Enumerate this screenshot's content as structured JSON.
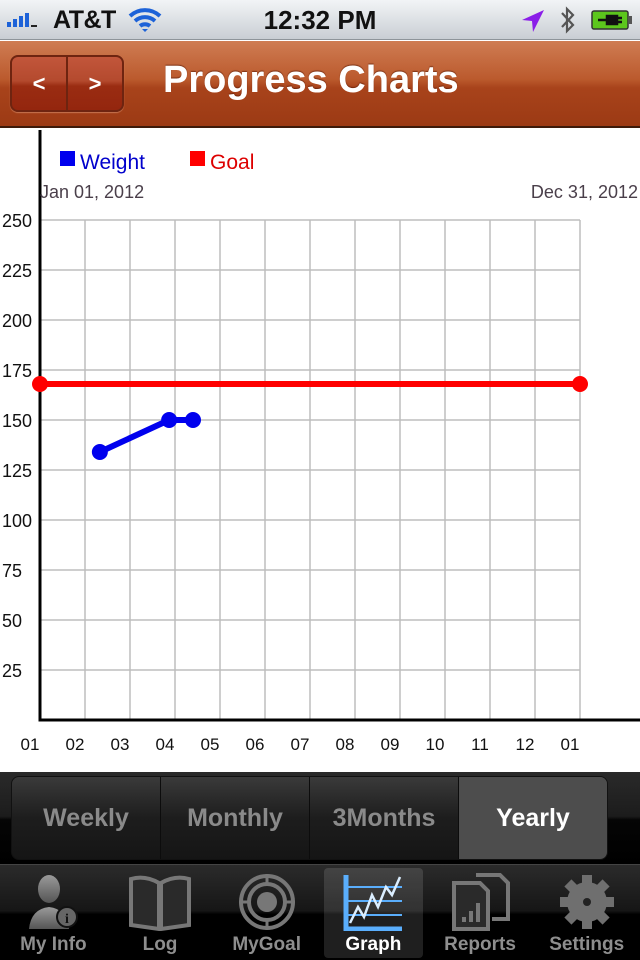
{
  "status_bar": {
    "carrier": "AT&T",
    "time": "12:32 PM",
    "signal_bars": 4,
    "icons": [
      "signal-icon",
      "wifi-icon",
      "location-arrow-icon",
      "bluetooth-icon",
      "battery-charging-icon"
    ]
  },
  "nav": {
    "title": "Progress Charts",
    "prev_label": "<",
    "next_label": ">"
  },
  "range_selector": {
    "options": [
      {
        "label": "Weekly",
        "selected": false
      },
      {
        "label": "Monthly",
        "selected": false
      },
      {
        "label": "3Months",
        "selected": false
      },
      {
        "label": "Yearly",
        "selected": true
      }
    ]
  },
  "tab_bar": {
    "items": [
      {
        "label": "My Info",
        "icon": "person-info-icon",
        "selected": false
      },
      {
        "label": "Log",
        "icon": "open-book-icon",
        "selected": false
      },
      {
        "label": "MyGoal",
        "icon": "target-icon",
        "selected": false
      },
      {
        "label": "Graph",
        "icon": "line-graph-icon",
        "selected": true
      },
      {
        "label": "Reports",
        "icon": "reports-documents-icon",
        "selected": false
      },
      {
        "label": "Settings",
        "icon": "gear-icon",
        "selected": false
      }
    ]
  },
  "colors": {
    "weight": "#0000ee",
    "goal": "#ff0000",
    "grid": "#bdbdbd",
    "axis": "#000000",
    "nav_brand": "#b44a22"
  },
  "chart_data": {
    "type": "line",
    "title": "",
    "date_range_start": "Jan 01, 2012",
    "date_range_end": "Dec 31, 2012",
    "xlabel": "",
    "ylabel": "",
    "x_ticks": [
      "01",
      "02",
      "03",
      "04",
      "05",
      "06",
      "07",
      "08",
      "09",
      "10",
      "11",
      "12",
      "01"
    ],
    "x_range_months": [
      0,
      12
    ],
    "y_ticks": [
      25,
      50,
      75,
      100,
      125,
      150,
      175,
      200,
      225,
      250
    ],
    "ylim": [
      0,
      250
    ],
    "grid": true,
    "legend": {
      "placement": "top-left",
      "entries": [
        {
          "name": "Weight",
          "color": "#0000ee"
        },
        {
          "name": "Goal",
          "color": "#ff0000"
        }
      ]
    },
    "series": [
      {
        "name": "Weight",
        "points": [
          {
            "month": 1.33,
            "value": 134
          },
          {
            "month": 2.87,
            "value": 150
          },
          {
            "month": 3.4,
            "value": 150
          }
        ]
      },
      {
        "name": "Goal",
        "points": [
          {
            "month": 0,
            "value": 168
          },
          {
            "month": 12,
            "value": 168
          }
        ]
      }
    ]
  }
}
